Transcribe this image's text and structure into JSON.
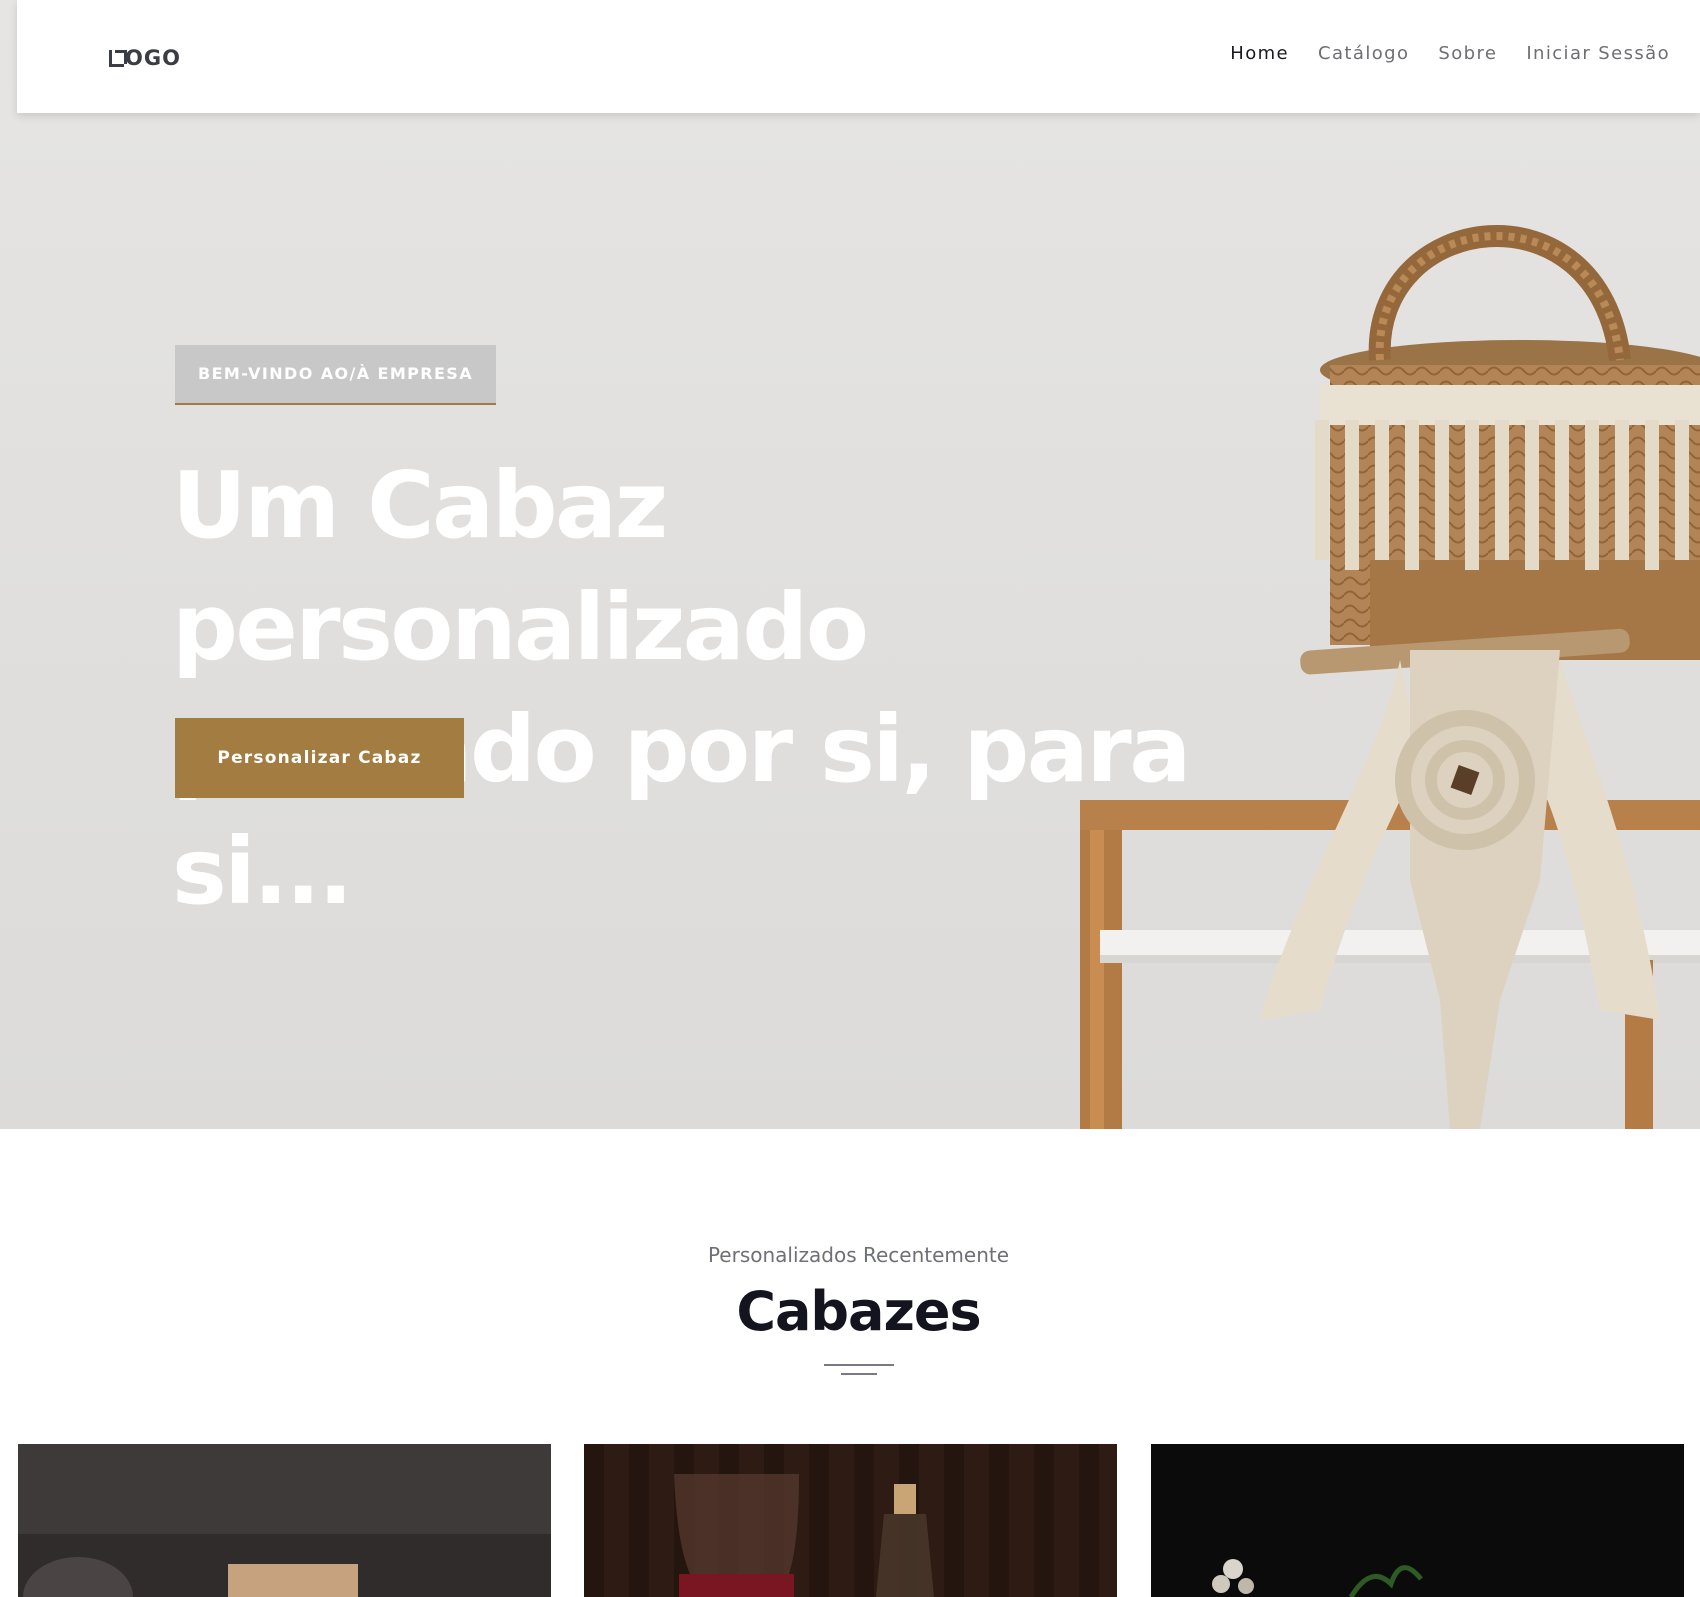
{
  "header": {
    "logo_text": "OGO",
    "nav": [
      {
        "label": "Home",
        "active": true
      },
      {
        "label": "Catálogo",
        "active": false
      },
      {
        "label": "Sobre",
        "active": false
      },
      {
        "label": "Iniciar Sessão",
        "active": false
      }
    ]
  },
  "hero": {
    "badge": "BEM-VINDO AO/À EMPRESA",
    "headline_line1": "Um Cabaz personalizado",
    "headline_line2": "pensado por si, para si...",
    "cta_label": "Personalizar Cabaz"
  },
  "section": {
    "subtitle": "Personalizados Recentemente",
    "title": "Cabazes"
  },
  "colors": {
    "accent": "#a27c41",
    "title": "#14141f",
    "hero_bg": "#e0dfdd"
  }
}
